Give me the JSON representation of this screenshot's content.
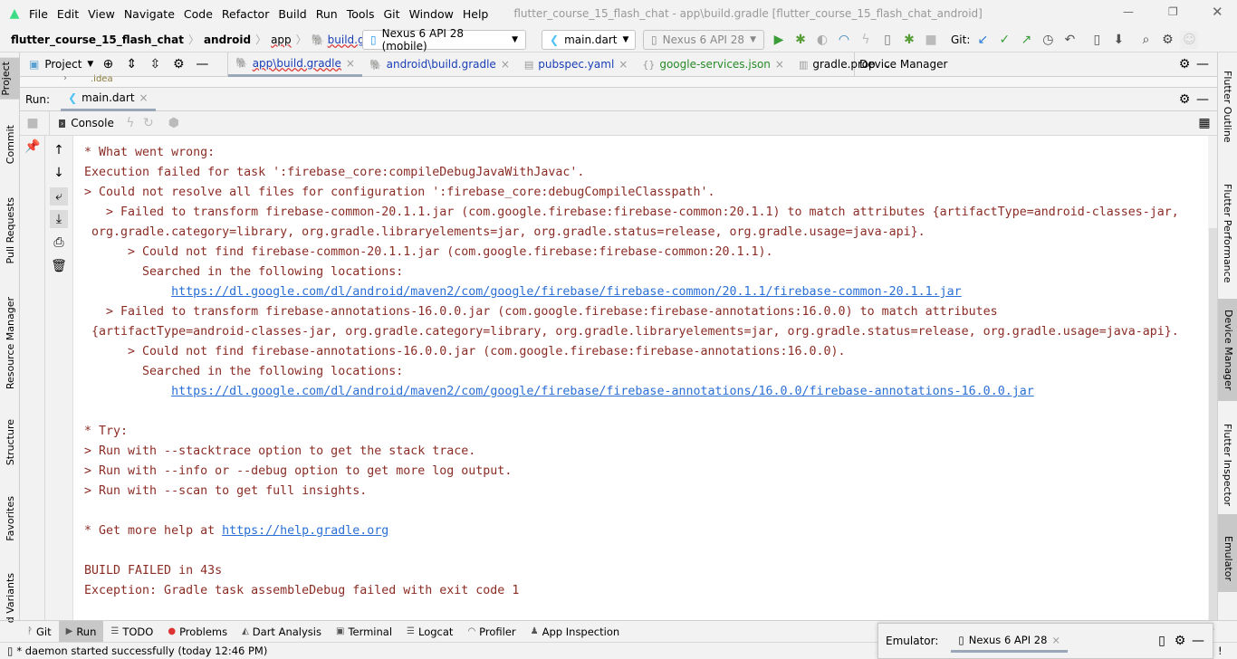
{
  "menu": [
    "File",
    "Edit",
    "View",
    "Navigate",
    "Code",
    "Refactor",
    "Build",
    "Run",
    "Tools",
    "Git",
    "Window",
    "Help"
  ],
  "window_title": "flutter_course_15_flash_chat - app\\build.gradle [flutter_course_15_flash_chat_android]",
  "breadcrumb": [
    "flutter_course_15_flash_chat",
    "android",
    "app",
    "build.gradle"
  ],
  "toolbar": {
    "device": "Nexus 6 API 28 (mobile)",
    "run_config": "main.dart",
    "device2": "Nexus 6 API 28",
    "git_label": "Git:"
  },
  "project_panel": {
    "label": "Project",
    "tree_item": ".idea"
  },
  "editor_tabs": [
    {
      "label": "app\\build.gradle",
      "color": "#1a3fb5"
    },
    {
      "label": "android\\build.gradle",
      "color": "#1a3fb5"
    },
    {
      "label": "pubspec.yaml",
      "color": "#1a3fb5"
    },
    {
      "label": "google-services.json",
      "color": "#268a26"
    },
    {
      "label": "gradle.prop",
      "color": "#000000"
    }
  ],
  "device_manager_title": "Device Manager",
  "run": {
    "label": "Run:",
    "tab": "main.dart",
    "console_tab": "Console"
  },
  "left_strip": [
    "Project",
    "Commit",
    "Pull Requests",
    "Resource Manager",
    "Structure",
    "Favorites",
    "d Variants"
  ],
  "right_strip": [
    "Flutter Outline",
    "Flutter Performance",
    "Device Manager",
    "Flutter Inspector",
    "Emulator"
  ],
  "console": {
    "text_color": "#8b2c25",
    "link_color": "#2a6fd6",
    "lines": [
      {
        "t": "* What went wrong:"
      },
      {
        "t": "Execution failed for task ':firebase_core:compileDebugJavaWithJavac'."
      },
      {
        "t": "> Could not resolve all files for configuration ':firebase_core:debugCompileClasspath'."
      },
      {
        "t": "   > Failed to transform firebase-common-20.1.1.jar (com.google.firebase:firebase-common:20.1.1) to match attributes {artifactType=android-classes-jar,"
      },
      {
        "t": " org.gradle.category=library, org.gradle.libraryelements=jar, org.gradle.status=release, org.gradle.usage=java-api}."
      },
      {
        "t": "      > Could not find firebase-common-20.1.1.jar (com.google.firebase:firebase-common:20.1.1)."
      },
      {
        "t": "        Searched in the following locations:"
      },
      {
        "t": "            ",
        "link": "https://dl.google.com/dl/android/maven2/com/google/firebase/firebase-common/20.1.1/firebase-common-20.1.1.jar"
      },
      {
        "t": "   > Failed to transform firebase-annotations-16.0.0.jar (com.google.firebase:firebase-annotations:16.0.0) to match attributes"
      },
      {
        "t": " {artifactType=android-classes-jar, org.gradle.category=library, org.gradle.libraryelements=jar, org.gradle.status=release, org.gradle.usage=java-api}."
      },
      {
        "t": "      > Could not find firebase-annotations-16.0.0.jar (com.google.firebase:firebase-annotations:16.0.0)."
      },
      {
        "t": "        Searched in the following locations:"
      },
      {
        "t": "            ",
        "link": "https://dl.google.com/dl/android/maven2/com/google/firebase/firebase-annotations/16.0.0/firebase-annotations-16.0.0.jar"
      },
      {
        "t": ""
      },
      {
        "t": "* Try:"
      },
      {
        "t": "> Run with --stacktrace option to get the stack trace."
      },
      {
        "t": "> Run with --info or --debug option to get more log output."
      },
      {
        "t": "> Run with --scan to get full insights."
      },
      {
        "t": ""
      },
      {
        "t": "* Get more help at ",
        "link": "https://help.gradle.org"
      },
      {
        "t": ""
      },
      {
        "t": "BUILD FAILED in 43s"
      },
      {
        "t": "Exception: Gradle task assembleDebug failed with exit code 1"
      }
    ]
  },
  "bottom_tabs": [
    "Git",
    "Run",
    "TODO",
    "Problems",
    "Dart Analysis",
    "Terminal",
    "Logcat",
    "Profiler",
    "App Inspection"
  ],
  "bottom_right_partial": "nspector",
  "status_text": "* daemon started successfully (today 12:46 PM)",
  "status_right_partial": "ter",
  "emulator": {
    "label": "Emulator:",
    "tab": "Nexus 6 API 28"
  }
}
